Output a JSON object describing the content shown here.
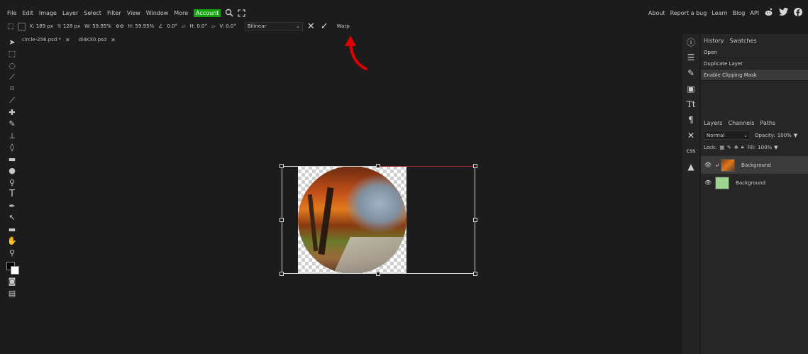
{
  "menubar": {
    "items": [
      "File",
      "Edit",
      "Image",
      "Layer",
      "Select",
      "Filter",
      "View",
      "Window",
      "More"
    ],
    "account": "Account",
    "right_items": [
      "About",
      "Report a bug",
      "Learn",
      "Blog",
      "API"
    ]
  },
  "options": {
    "x": "X: 189 px",
    "y": "Y: 128 px",
    "w": "W: 59.95%",
    "h": "H: 59.95%",
    "rot": "0.0°",
    "skew_h": "H: 0.0°",
    "skew_v": "V: 0.0°",
    "interp": "Bilinear",
    "warp": "Warp"
  },
  "tabs": [
    {
      "label": "circle-256.psd *"
    },
    {
      "label": "di4KX0.psd"
    }
  ],
  "history": {
    "tabs": [
      "History",
      "Swatches"
    ],
    "items": [
      "Open",
      "Duplicate Layer",
      "Enable Clipping Mask"
    ]
  },
  "layers": {
    "tabs": [
      "Layers",
      "Channels",
      "Paths"
    ],
    "blend": "Normal",
    "opacity_label": "Opacity:",
    "opacity": "100%",
    "lock_label": "Lock:",
    "fill_label": "Fill:",
    "fill": "100%",
    "rows": [
      {
        "name": "Background"
      },
      {
        "name": "Background"
      }
    ]
  },
  "colors": {
    "accent_green": "#13a10e",
    "arrow_red": "#e00000"
  }
}
